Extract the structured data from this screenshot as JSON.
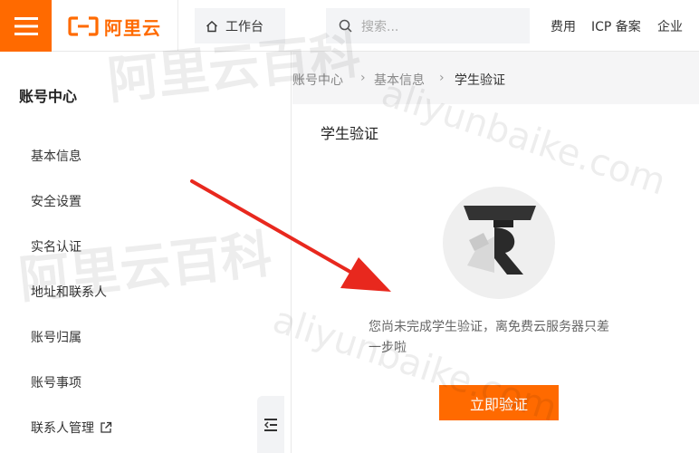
{
  "header": {
    "brand": "阿里云",
    "workbench": "工作台",
    "search_placeholder": "搜索...",
    "nav": [
      "费用",
      "ICP 备案",
      "企业"
    ]
  },
  "sidebar": {
    "title": "账号中心",
    "items": [
      {
        "label": "基本信息"
      },
      {
        "label": "安全设置"
      },
      {
        "label": "实名认证"
      },
      {
        "label": "地址和联系人"
      },
      {
        "label": "账号归属"
      },
      {
        "label": "账号事项"
      },
      {
        "label": "联系人管理"
      }
    ]
  },
  "breadcrumb": [
    "账号中心",
    "基本信息",
    "学生验证"
  ],
  "main": {
    "title": "学生验证",
    "description_line1": "您尚未完成学生验证，离免费云服务器只差",
    "description_line2": "一步啦",
    "cta": "立即验证"
  },
  "watermarks": {
    "brand_text": "阿里云百科",
    "url_text": "aliyunbaike.com"
  },
  "colors": {
    "accent": "#ff6a00",
    "arrow": "#e8281e"
  }
}
